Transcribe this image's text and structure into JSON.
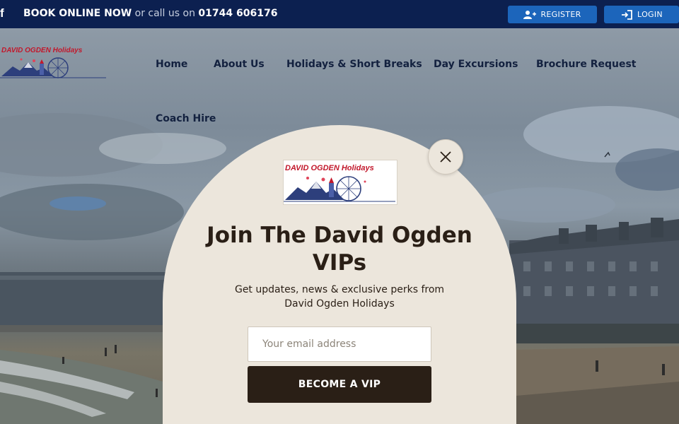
{
  "topbar": {
    "facebook_icon": "f",
    "book_online": "BOOK ONLINE NOW",
    "call_text": " or call us on ",
    "phone": "01744 606176",
    "register_label": "REGISTER",
    "register_icon": "user-plus-icon",
    "login_label": "LOGIN",
    "login_icon": "sign-in-icon"
  },
  "brand": {
    "logo_text": "DAVID OGDEN Holidays",
    "logo_color": "#c2182b"
  },
  "nav": {
    "items": [
      {
        "label": "Home"
      },
      {
        "label": "About Us"
      },
      {
        "label": "Holidays & Short Breaks"
      },
      {
        "label": "Day Excursions"
      },
      {
        "label": "Brochure Request"
      },
      {
        "label": "Coach Hire"
      }
    ]
  },
  "popup": {
    "logo_text": "DAVID OGDEN Holidays",
    "title": "Join The David Ogden VIPs",
    "subtitle": "Get updates, news & exclusive perks from David Ogden Holidays",
    "email_placeholder": "Your email address",
    "email_value": "",
    "submit_label": "BECOME A VIP",
    "close_icon": "close-icon"
  },
  "colors": {
    "topbar_bg": "#0c2050",
    "button_blue": "#1c65bb",
    "popup_bg": "#ece6dc",
    "popup_dark": "#2a1f16"
  }
}
